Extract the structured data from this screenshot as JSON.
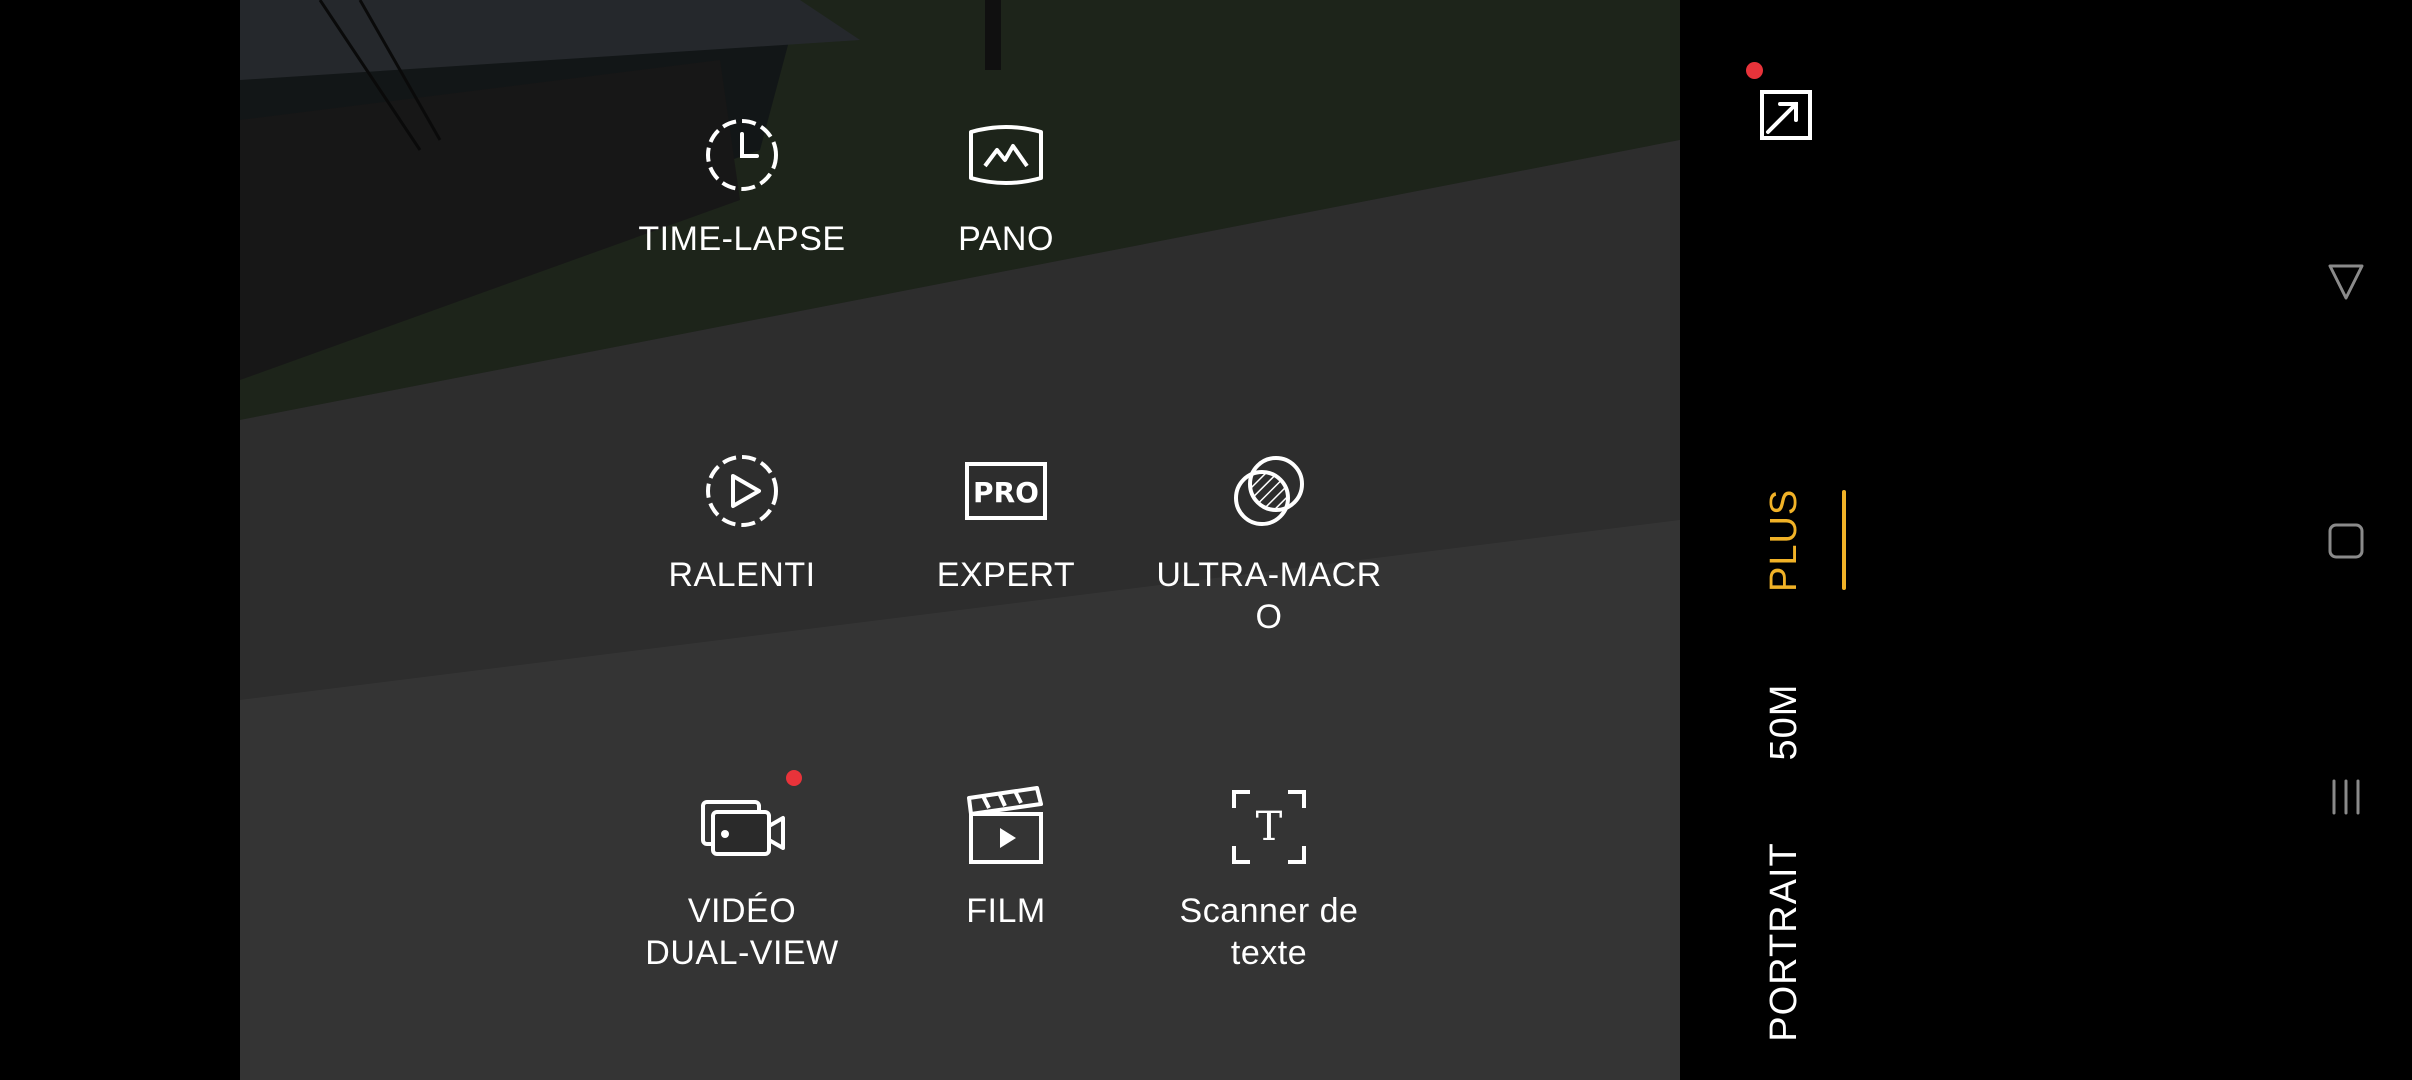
{
  "modes": [
    {
      "label": "TIME-LAPSE",
      "icon": "timelapse-icon"
    },
    {
      "label": "PANO",
      "icon": "panorama-icon"
    },
    {
      "label": "RALENTI",
      "icon": "slow-motion-icon"
    },
    {
      "label": "EXPERT",
      "icon": "pro-icon",
      "icon_text": "PRO"
    },
    {
      "label": "ULTRA-MACR\nO",
      "icon": "ultra-macro-icon"
    },
    {
      "label": "VIDÉO\nDUAL-VIEW",
      "icon": "dual-view-video-icon",
      "badge": true
    },
    {
      "label": "FILM",
      "icon": "clapperboard-icon"
    },
    {
      "label": "Scanner de\ntexte",
      "icon": "text-scanner-icon",
      "icon_text": "T"
    }
  ],
  "right_panel": {
    "exit_icon": "collapse-icon",
    "camera_modes": [
      {
        "label": "PLUS",
        "active": true
      },
      {
        "label": "50M",
        "active": false
      },
      {
        "label": "PORTRAIT",
        "active": false
      }
    ]
  },
  "navigation": {
    "back": "back-icon",
    "home": "home-icon",
    "recents": "recents-icon"
  },
  "colors": {
    "accent": "#f1b227",
    "badge": "#e8333a",
    "text": "#ffffff"
  }
}
